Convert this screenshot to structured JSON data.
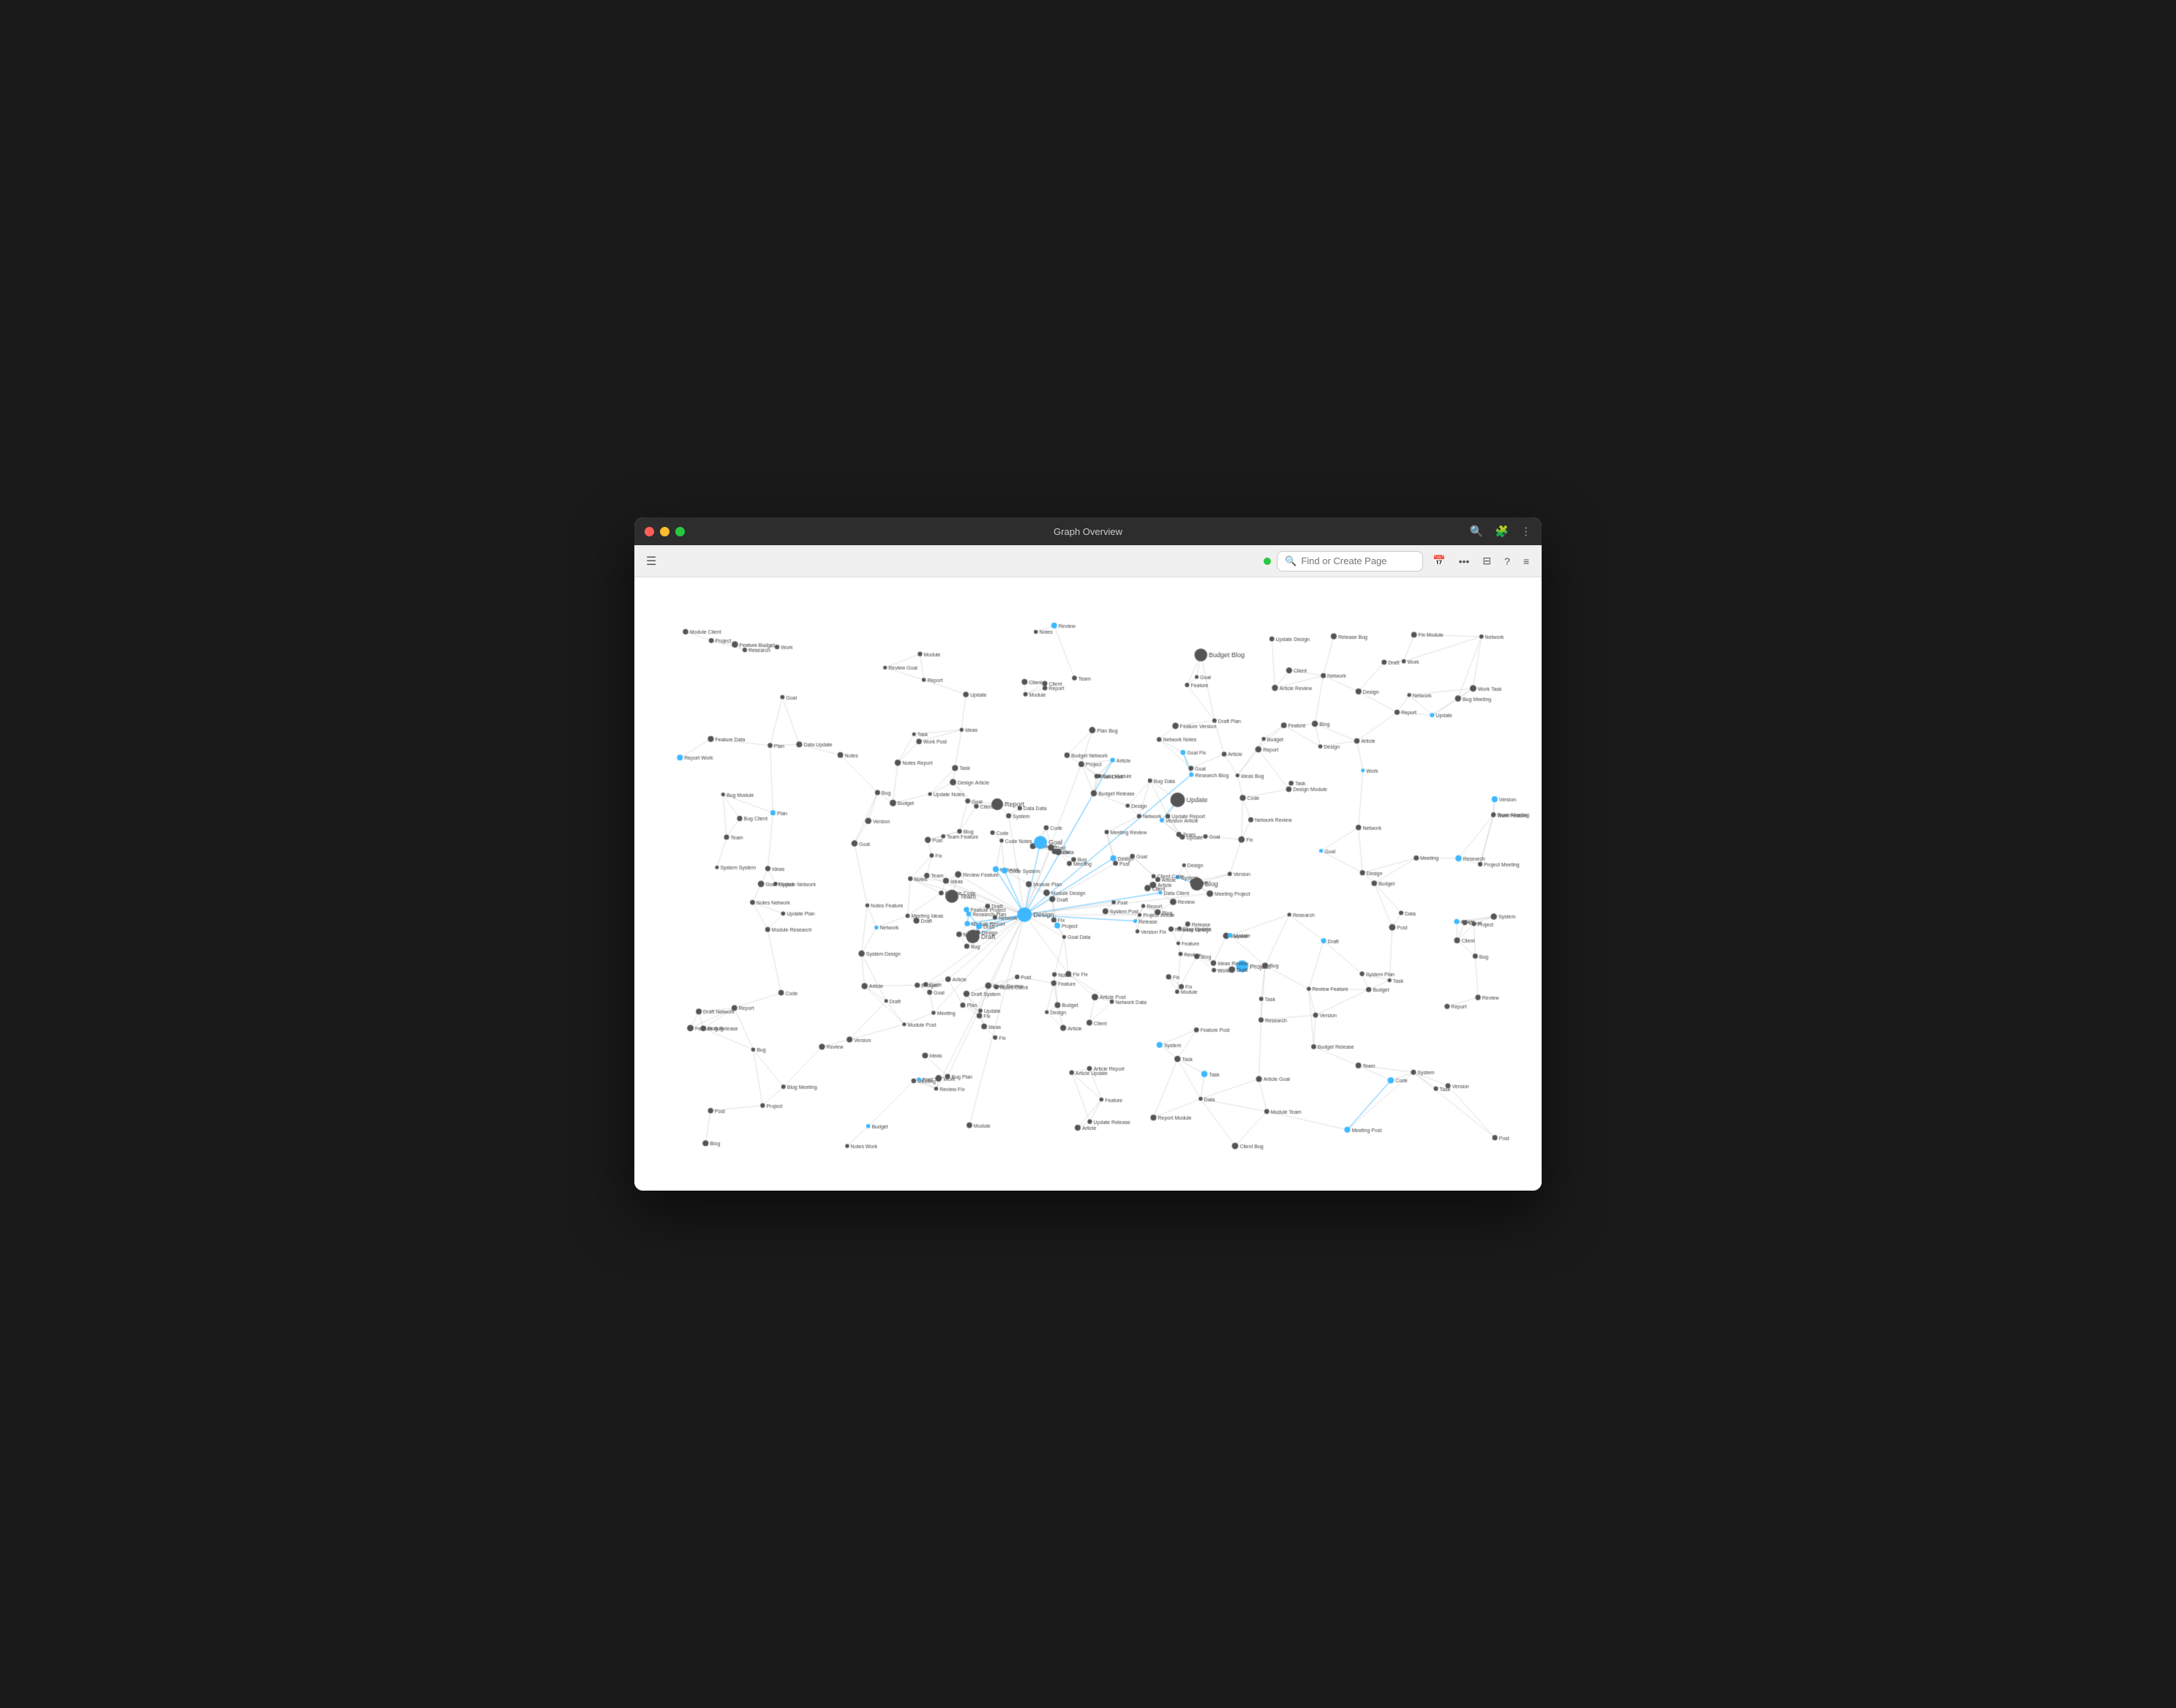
{
  "window": {
    "title": "Graph Overview"
  },
  "titlebar": {
    "traffic_lights": {
      "close_color": "#ff5f57",
      "minimize_color": "#febc2e",
      "maximize_color": "#28c840"
    },
    "right_icons": [
      "search",
      "puzzle",
      "more-vertical"
    ]
  },
  "toolbar": {
    "hamburger_label": "☰",
    "status_color": "#28c840",
    "search_placeholder": "Find or Create Page",
    "icons": {
      "calendar": "📅",
      "more": "•••",
      "columns": "⊟",
      "help": "?",
      "list": "≡"
    }
  },
  "graph": {
    "node_color_normal": "#555555",
    "node_color_highlighted": "#3db8ff",
    "edge_color_normal": "rgba(160,160,160,0.5)",
    "edge_color_highlighted": "rgba(61,184,255,0.7)",
    "background": "#ffffff"
  }
}
